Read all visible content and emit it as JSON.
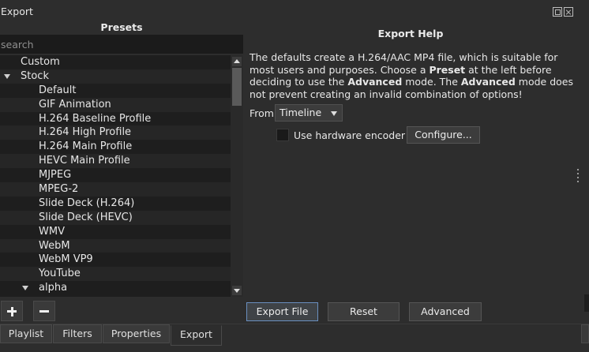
{
  "window": {
    "title": "Export"
  },
  "presets": {
    "header": "Presets",
    "search_placeholder": "search",
    "items": [
      {
        "label": "Custom",
        "level": 0,
        "expanded": false,
        "has_children": false
      },
      {
        "label": "Stock",
        "level": 0,
        "expanded": true,
        "has_children": true
      },
      {
        "label": "Default",
        "level": 1
      },
      {
        "label": "GIF Animation",
        "level": 1
      },
      {
        "label": "H.264 Baseline Profile",
        "level": 1
      },
      {
        "label": "H.264 High Profile",
        "level": 1
      },
      {
        "label": "H.264 Main Profile",
        "level": 1
      },
      {
        "label": "HEVC Main Profile",
        "level": 1
      },
      {
        "label": "MJPEG",
        "level": 1
      },
      {
        "label": "MPEG-2",
        "level": 1
      },
      {
        "label": "Slide Deck (H.264)",
        "level": 1
      },
      {
        "label": "Slide Deck (HEVC)",
        "level": 1
      },
      {
        "label": "WMV",
        "level": 1
      },
      {
        "label": "WebM",
        "level": 1
      },
      {
        "label": "WebM VP9",
        "level": 1
      },
      {
        "label": "YouTube",
        "level": 1
      },
      {
        "label": "alpha",
        "level": 1,
        "expanded": true,
        "has_children": true
      }
    ]
  },
  "help": {
    "title": "Export Help",
    "text_parts": [
      {
        "t": "The defaults create a H.264/AAC MP4 file, which is suitable for most users and purposes. Choose a ",
        "b": false
      },
      {
        "t": "Preset",
        "b": true
      },
      {
        "t": " at the left before deciding to use the ",
        "b": false
      },
      {
        "t": "Advanced",
        "b": true
      },
      {
        "t": " mode. The ",
        "b": false
      },
      {
        "t": "Advanced",
        "b": true
      },
      {
        "t": " mode does not prevent creating an invalid combination of options!",
        "b": false
      }
    ]
  },
  "form": {
    "from_label": "From",
    "from_value": "Timeline",
    "hw_encoder_label": "Use hardware encoder",
    "hw_encoder_checked": false,
    "configure_label": "Configure..."
  },
  "actions": {
    "export_file": "Export File",
    "reset": "Reset",
    "advanced": "Advanced"
  },
  "tabs": [
    {
      "label": "Playlist",
      "active": false
    },
    {
      "label": "Filters",
      "active": false
    },
    {
      "label": "Properties",
      "active": false
    },
    {
      "label": "Export",
      "active": true
    }
  ],
  "colors": {
    "background": "#2d2d2d",
    "list_background": "#1e1e1e",
    "list_alt_row": "#262626",
    "button": "#3c3c3c",
    "focus_border": "#6a8fbf",
    "text": "#e8e8e8"
  }
}
